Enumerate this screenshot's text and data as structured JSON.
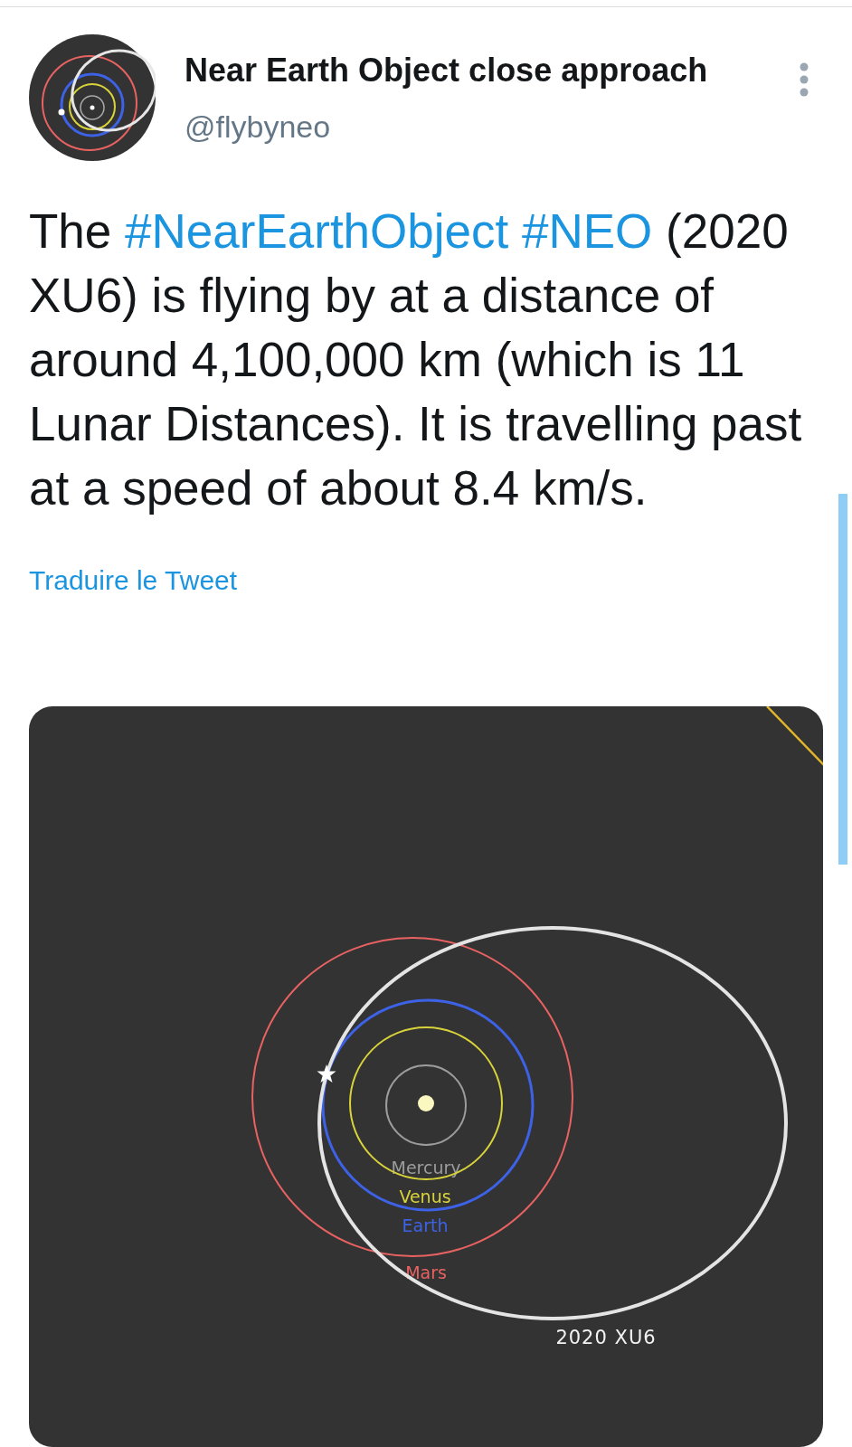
{
  "author": {
    "name": "Near Earth Object close approach",
    "handle": "@flybyneo"
  },
  "text": [
    {
      "kind": "plain",
      "text": "The"
    },
    {
      "kind": "hashtag",
      "text": "#NearEarthObject"
    },
    {
      "kind": "hashtag",
      "text": "#NEO"
    },
    {
      "kind": "plain",
      "text": "(2020 XU6) is flying by at a distance of around 4,100,000 km (which is 11 Lunar Distances). It is travelling past at a speed of about 8.4 km/s."
    }
  ],
  "translate_link": "Traduire le Tweet",
  "media": {
    "orbits": [
      {
        "name": "Mercury",
        "color": "#9c9c9c"
      },
      {
        "name": "Venus",
        "color": "#d8d33a"
      },
      {
        "name": "Earth",
        "color": "#3d62e6"
      },
      {
        "name": "Mars",
        "color": "#e86262"
      }
    ],
    "object_label": "2020 XU6"
  }
}
